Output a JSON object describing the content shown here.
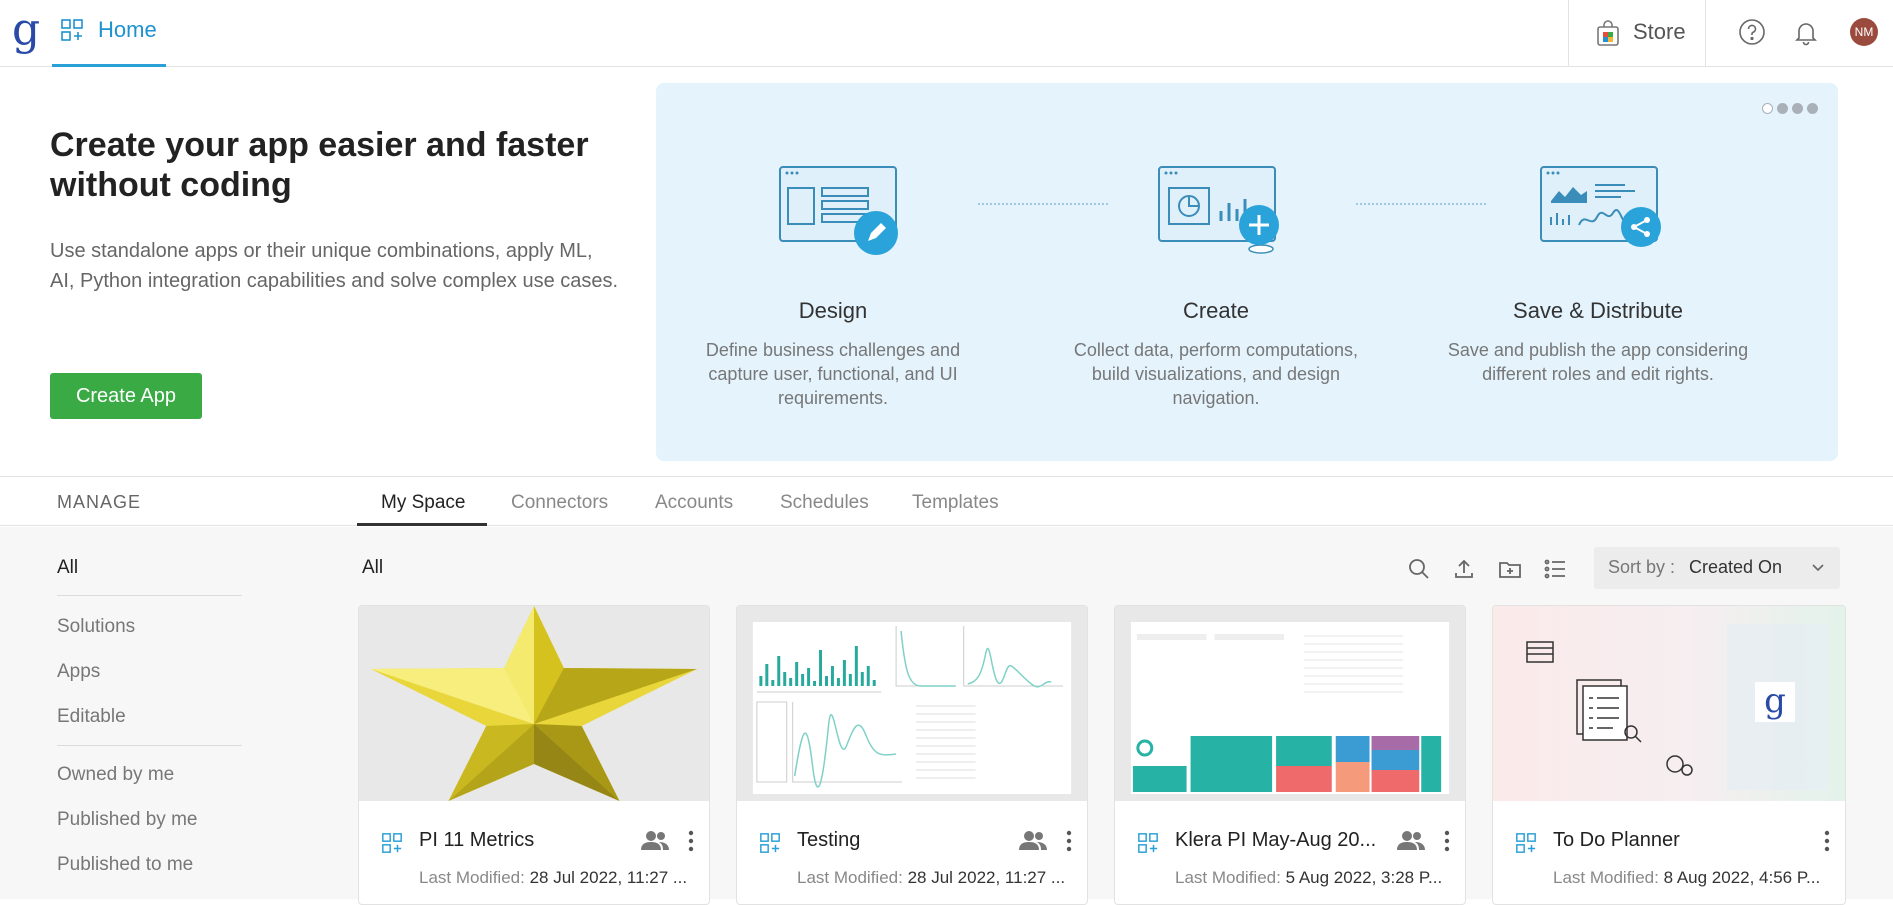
{
  "topbar": {
    "logo": "g",
    "home_label": "Home",
    "store_label": "Store",
    "avatar_initials": "NM"
  },
  "hero": {
    "title": "Create your app easier and faster without coding",
    "description": "Use standalone apps or their unique combinations, apply ML, AI, Python integration capabilities and solve complex use cases.",
    "create_button": "Create App"
  },
  "banner": {
    "steps": [
      {
        "title": "Design",
        "desc": "Define business challenges and capture user, functional, and UI requirements."
      },
      {
        "title": "Create",
        "desc": "Collect data, perform computations, build visualizations, and design navigation."
      },
      {
        "title": "Save & Distribute",
        "desc": "Save and publish the app considering different roles and edit rights."
      }
    ]
  },
  "manage_label": "MANAGE",
  "tabs": [
    "My Space",
    "Connectors",
    "Accounts",
    "Schedules",
    "Templates"
  ],
  "sidebar": {
    "items": [
      "All",
      "Solutions",
      "Apps",
      "Editable",
      "Owned by me",
      "Published by me",
      "Published to me"
    ]
  },
  "toolbar": {
    "filter_label": "All",
    "sort_key": "Sort by :",
    "sort_value": "Created On"
  },
  "cards": [
    {
      "name": "PI 11 Metrics",
      "meta_label": "Last Modified:",
      "meta_value": "28 Jul 2022, 11:27 ..."
    },
    {
      "name": "Testing",
      "meta_label": "Last Modified:",
      "meta_value": "28 Jul 2022, 11:27 ..."
    },
    {
      "name": "Klera PI May-Aug 20...",
      "meta_label": "Last Modified:",
      "meta_value": "5 Aug 2022, 3:28 P..."
    },
    {
      "name": "To Do Planner",
      "meta_label": "Last Modified:",
      "meta_value": "8 Aug 2022, 4:56 P..."
    }
  ],
  "colors": {
    "accent": "#1e93cf",
    "create_button": "#3aaa45",
    "banner_bg": "#e4f3fc"
  }
}
